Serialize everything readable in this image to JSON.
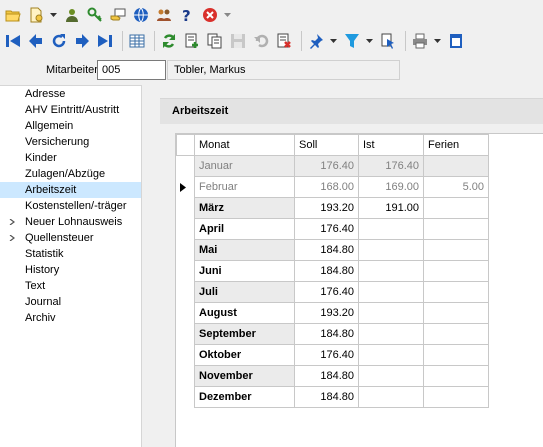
{
  "toolbar1": {
    "icons": [
      "folder-open-icon",
      "document-new-icon",
      "user-group-icon",
      "key-icon",
      "card-hand-icon",
      "globe-icon",
      "people-search-icon",
      "help-icon",
      "stop-icon",
      "overflow-icon"
    ],
    "colors": {
      "blue": "#1f5fbf",
      "green": "#2e8b2e",
      "red": "#d9302b"
    }
  },
  "toolbar2": {
    "icons": [
      "first-record-icon",
      "previous-record-icon",
      "refresh-record-icon",
      "next-record-icon",
      "last-record-icon",
      "table-view-icon",
      "reload-icon",
      "add-record-icon",
      "copy-record-icon",
      "save-icon",
      "undo-icon",
      "delete-icon",
      "pin-icon",
      "filter-icon",
      "export-icon",
      "print-icon",
      "window-icon"
    ]
  },
  "filter": {
    "label": "Mitarbeiter",
    "value": "005",
    "name": "Tobler, Markus"
  },
  "nav": {
    "selected": "Arbeitszeit",
    "items": [
      {
        "label": "Adresse",
        "expandable": false
      },
      {
        "label": "AHV Eintritt/Austritt",
        "expandable": false
      },
      {
        "label": "Allgemein",
        "expandable": false
      },
      {
        "label": "Versicherung",
        "expandable": false
      },
      {
        "label": "Kinder",
        "expandable": false
      },
      {
        "label": "Zulagen/Abzüge",
        "expandable": false
      },
      {
        "label": "Arbeitszeit",
        "expandable": false
      },
      {
        "label": "Kostenstellen/-träger",
        "expandable": false
      },
      {
        "label": "Neuer Lohnausweis",
        "expandable": true
      },
      {
        "label": "Quellensteuer",
        "expandable": true
      },
      {
        "label": "Statistik",
        "expandable": false
      },
      {
        "label": "History",
        "expandable": false
      },
      {
        "label": "Text",
        "expandable": false
      },
      {
        "label": "Journal",
        "expandable": false
      },
      {
        "label": "Archiv",
        "expandable": false
      }
    ]
  },
  "section": {
    "title": "Arbeitszeit"
  },
  "grid": {
    "columns": [
      "Monat",
      "Soll",
      "Ist",
      "Ferien"
    ],
    "rows": [
      {
        "monat": "Januar",
        "soll": "176.40",
        "ist": "176.40",
        "ferien": "",
        "state": "gray"
      },
      {
        "monat": "Februar",
        "soll": "168.00",
        "ist": "169.00",
        "ferien": "5.00",
        "state": "current"
      },
      {
        "monat": "März",
        "soll": "193.20",
        "ist": "191.00",
        "ferien": "",
        "state": "shade"
      },
      {
        "monat": "April",
        "soll": "176.40",
        "ist": "",
        "ferien": "",
        "state": "plain"
      },
      {
        "monat": "Mai",
        "soll": "184.80",
        "ist": "",
        "ferien": "",
        "state": "shade"
      },
      {
        "monat": "Juni",
        "soll": "184.80",
        "ist": "",
        "ferien": "",
        "state": "plain"
      },
      {
        "monat": "Juli",
        "soll": "176.40",
        "ist": "",
        "ferien": "",
        "state": "shade"
      },
      {
        "monat": "August",
        "soll": "193.20",
        "ist": "",
        "ferien": "",
        "state": "plain"
      },
      {
        "monat": "September",
        "soll": "184.80",
        "ist": "",
        "ferien": "",
        "state": "shade"
      },
      {
        "monat": "Oktober",
        "soll": "176.40",
        "ist": "",
        "ferien": "",
        "state": "plain"
      },
      {
        "monat": "November",
        "soll": "184.80",
        "ist": "",
        "ferien": "",
        "state": "shade"
      },
      {
        "monat": "Dezember",
        "soll": "184.80",
        "ist": "",
        "ferien": "",
        "state": "plain"
      }
    ]
  }
}
